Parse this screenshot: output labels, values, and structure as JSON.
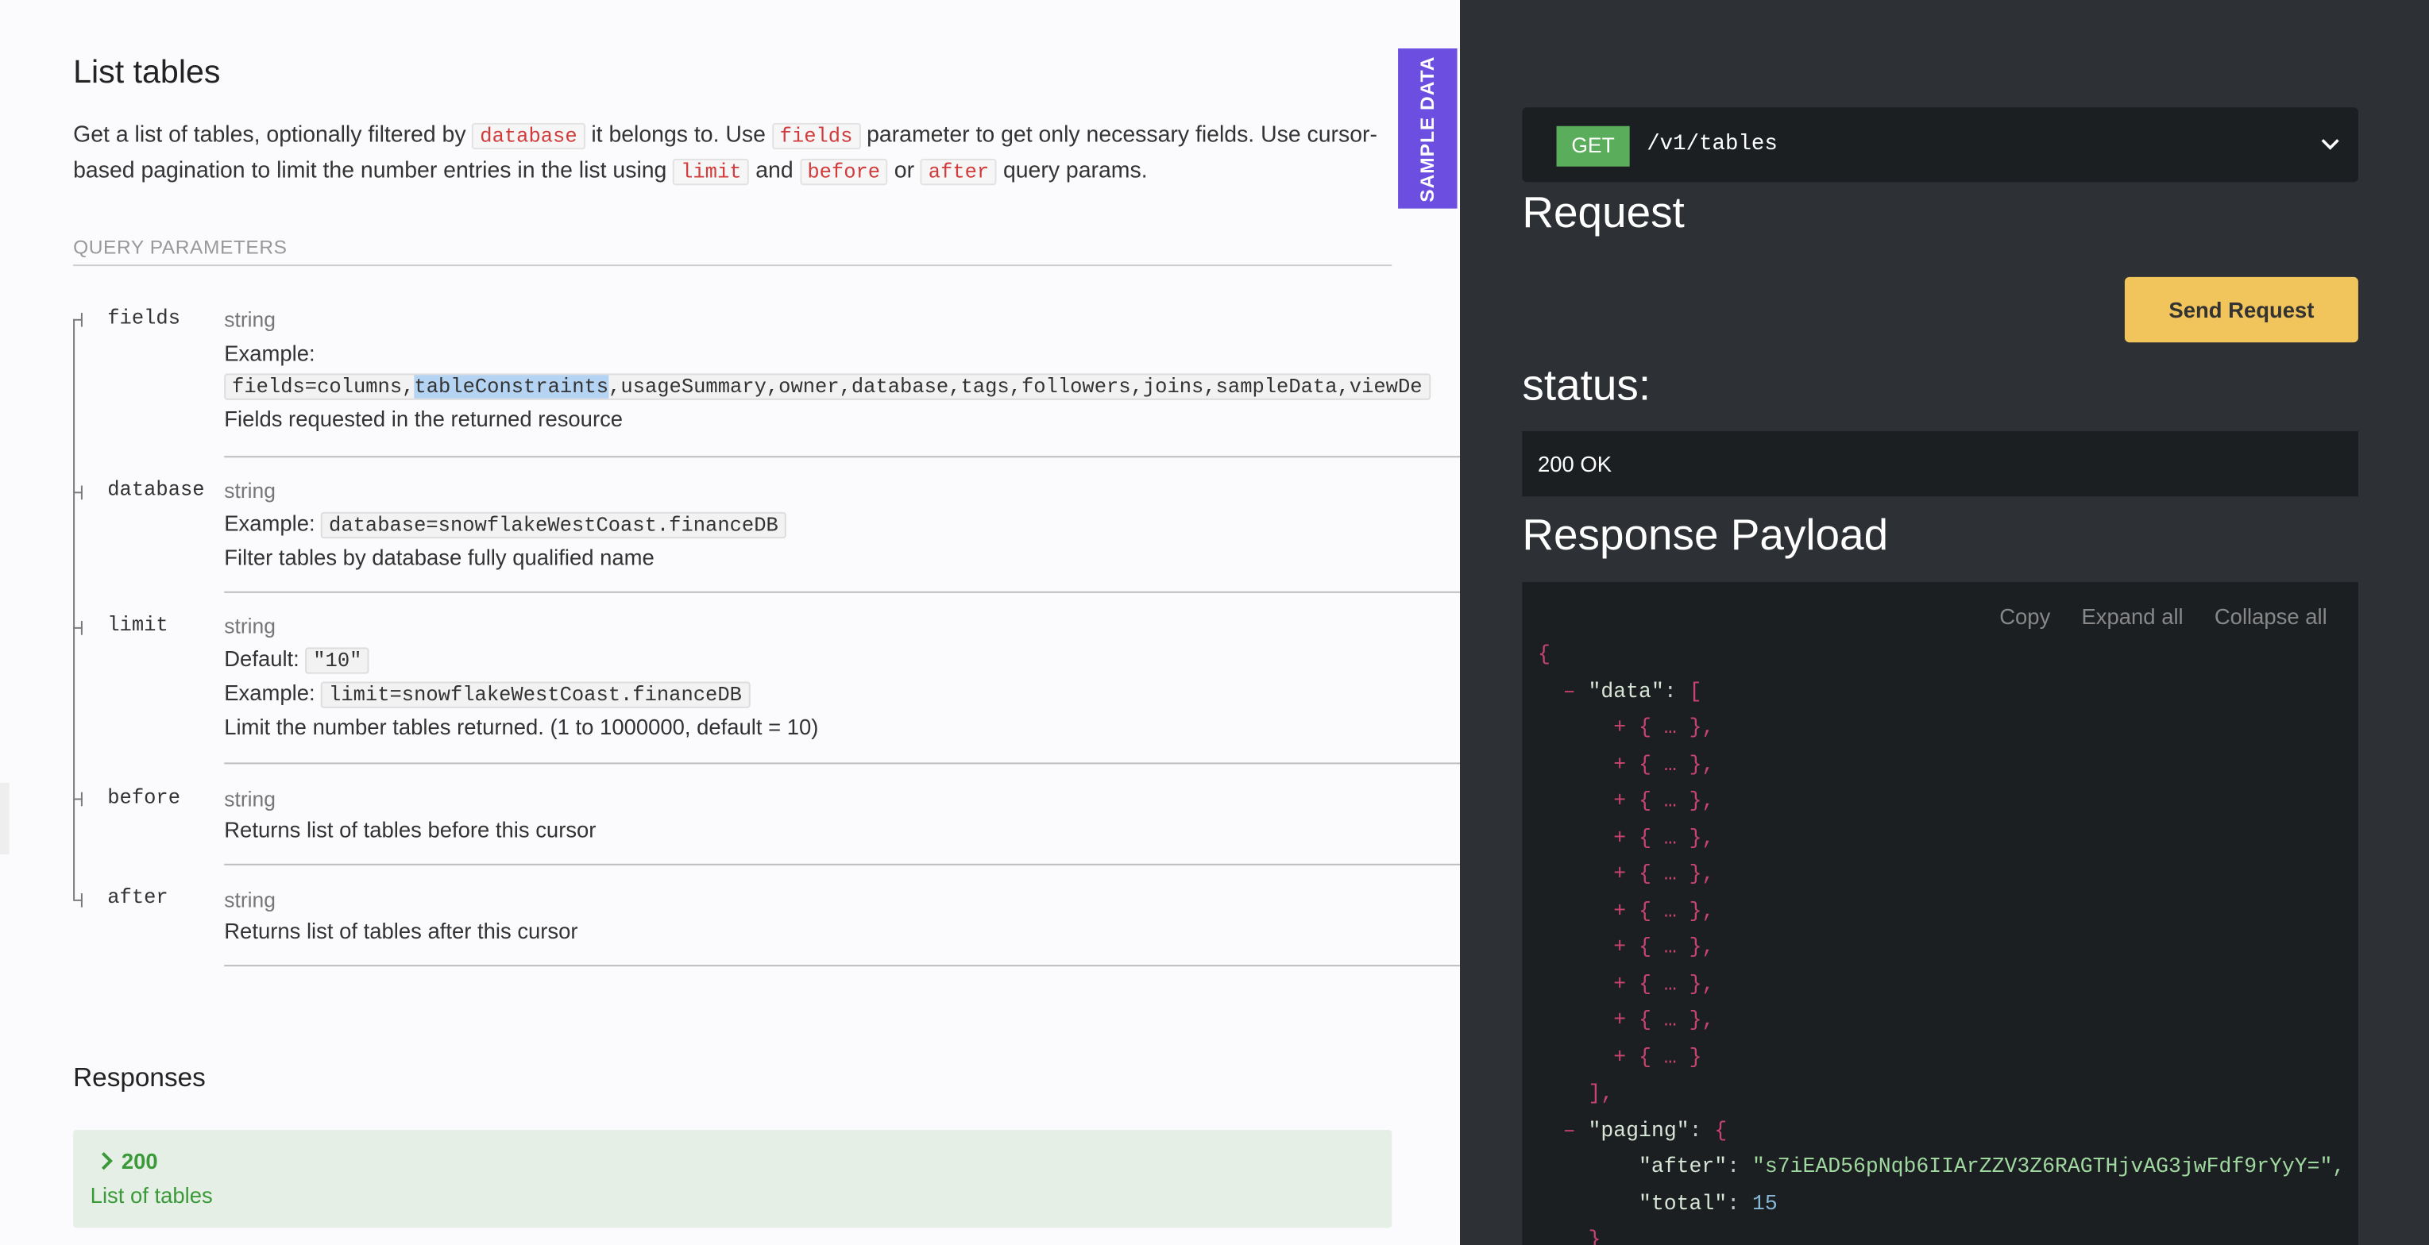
{
  "title": "List tables",
  "description": {
    "t1": "Get a list of tables, optionally filtered by ",
    "c1": "database",
    "t2": " it belongs to. Use ",
    "c2": "fields",
    "t3": " parameter to get only necessary fields. Use cursor-based pagination to limit the number entries in the list using ",
    "c3": "limit",
    "t4": " and ",
    "c4": "before",
    "t5": " or ",
    "c5": "after",
    "t6": " query params."
  },
  "query_params_heading": "QUERY PARAMETERS",
  "params": [
    {
      "name": "fields",
      "type": "string",
      "example_label": "Example:",
      "example_pre": "fields=columns,",
      "example_hl": "tableConstraints",
      "example_post": ",usageSummary,owner,database,tags,followers,joins,sampleData,viewDe",
      "desc": "Fields requested in the returned resource"
    },
    {
      "name": "database",
      "type": "string",
      "example_label": "Example:",
      "example": "database=snowflakeWestCoast.financeDB",
      "desc": "Filter tables by database fully qualified name"
    },
    {
      "name": "limit",
      "type": "string",
      "default_label": "Default:",
      "default": "\"10\"",
      "example_label": "Example:",
      "example": "limit=snowflakeWestCoast.financeDB",
      "desc": "Limit the number tables returned. (1 to 1000000, default = 10)"
    },
    {
      "name": "before",
      "type": "string",
      "desc": "Returns list of tables before this cursor"
    },
    {
      "name": "after",
      "type": "string",
      "desc": "Returns list of tables after this cursor"
    }
  ],
  "responses": {
    "heading": "Responses",
    "code": "200",
    "desc": "List of tables"
  },
  "sample_tab": "SAMPLE DATA",
  "endpoint": {
    "method": "GET",
    "path": "/v1/tables"
  },
  "request_heading": "Request",
  "send_button": "Send Request",
  "status_heading": "status:",
  "status_value": "200 OK",
  "payload_heading": "Response Payload",
  "payload_tools": {
    "copy": "Copy",
    "expand": "Expand all",
    "collapse": "Collapse all"
  },
  "payload": {
    "open_brace": "{",
    "minus": "–",
    "plus": "+",
    "data_key": "\"data\"",
    "colon": ": ",
    "open_bracket": "[",
    "collapsed_item": "{ … },",
    "collapsed_last": "{ … }",
    "close_bracket": "],",
    "paging_key": "\"paging\"",
    "open_obj": "{",
    "after_key": "\"after\"",
    "after_value": "\"s7iEAD56pNqb6IIArZZV3Z6RAGTHjvAG3jwFdf9rYyY=\",",
    "total_key": "\"total\"",
    "total_value": "15",
    "close_obj": "}"
  },
  "colors": {
    "accent_purple": "#6c4fe0",
    "send_button": "#f2c55c",
    "get_badge": "#5aad5a",
    "response_green": "#3a9a3a"
  }
}
